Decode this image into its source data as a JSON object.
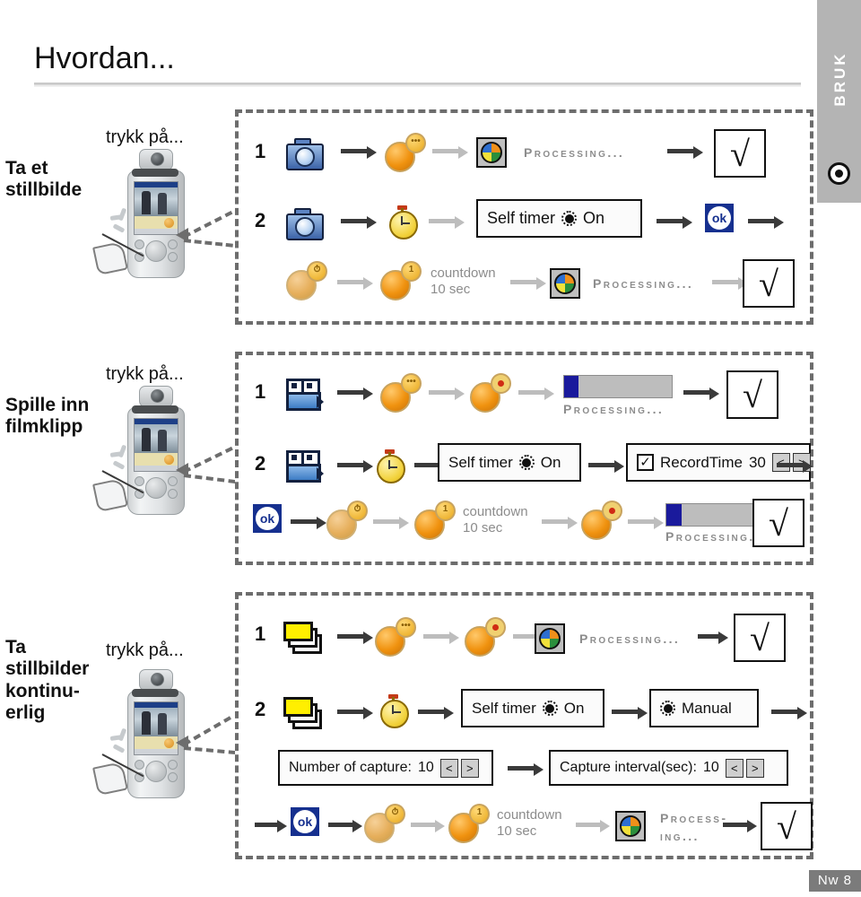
{
  "page": {
    "title": "Hvordan...",
    "footer_badge": "Nw 8",
    "sidebar_tab_label": "BRUK",
    "sidebar_icon": "bullseye-icon"
  },
  "sections": [
    {
      "id": "still-photo",
      "label": "Ta et\nstillbilde",
      "press_label": "trykk på...",
      "device_icon": "pda-camera-device",
      "steps": [
        {
          "num": "1",
          "items": [
            {
              "kind": "icon",
              "icon": "still-camera-icon"
            },
            {
              "kind": "arrow",
              "tone": "dark"
            },
            {
              "kind": "icon",
              "icon": "shutter-orb-icon",
              "badge": "•••"
            },
            {
              "kind": "arrow",
              "tone": "light"
            },
            {
              "kind": "icon",
              "icon": "color-wheel-icon"
            },
            {
              "kind": "text",
              "text": "Processing...",
              "style": "processing"
            },
            {
              "kind": "arrow",
              "tone": "dark"
            },
            {
              "kind": "icon",
              "icon": "checkmark-box",
              "glyph": "√"
            }
          ]
        },
        {
          "num": "2",
          "items": [
            {
              "kind": "icon",
              "icon": "still-camera-icon"
            },
            {
              "kind": "arrow",
              "tone": "dark"
            },
            {
              "kind": "icon",
              "icon": "stopwatch-icon"
            },
            {
              "kind": "arrow",
              "tone": "light"
            },
            {
              "kind": "dialog",
              "text": "Self timer",
              "control": "radio-on",
              "value": "On"
            },
            {
              "kind": "arrow",
              "tone": "dark"
            },
            {
              "kind": "icon",
              "icon": "ok-button-icon",
              "label": "ok"
            },
            {
              "kind": "arrow",
              "tone": "dark"
            }
          ]
        },
        {
          "num": "",
          "items": [
            {
              "kind": "icon",
              "icon": "shutter-orb-icon",
              "badge": "timer"
            },
            {
              "kind": "arrow",
              "tone": "light"
            },
            {
              "kind": "icon",
              "icon": "shutter-orb-icon",
              "badge": "1"
            },
            {
              "kind": "text",
              "text": "countdown",
              "text2": "10 sec",
              "style": "countdown"
            },
            {
              "kind": "arrow",
              "tone": "light"
            },
            {
              "kind": "icon",
              "icon": "color-wheel-icon"
            },
            {
              "kind": "text",
              "text": "Processing...",
              "style": "processing"
            },
            {
              "kind": "arrow",
              "tone": "light"
            },
            {
              "kind": "icon",
              "icon": "checkmark-box",
              "glyph": "√"
            }
          ]
        }
      ]
    },
    {
      "id": "video-clip",
      "label": "Spille inn\nfilmklipp",
      "press_label": "trykk på...",
      "device_icon": "pda-camera-device",
      "steps": [
        {
          "num": "1",
          "items": [
            {
              "kind": "icon",
              "icon": "video-camera-icon"
            },
            {
              "kind": "arrow",
              "tone": "dark"
            },
            {
              "kind": "icon",
              "icon": "shutter-orb-icon",
              "badge": "•••"
            },
            {
              "kind": "arrow",
              "tone": "light"
            },
            {
              "kind": "icon",
              "icon": "shutter-orb-icon",
              "badge": "rec"
            },
            {
              "kind": "arrow",
              "tone": "light"
            },
            {
              "kind": "progress",
              "percent": 13,
              "caption": "Processing..."
            },
            {
              "kind": "arrow",
              "tone": "dark"
            },
            {
              "kind": "icon",
              "icon": "checkmark-box",
              "glyph": "√"
            }
          ]
        },
        {
          "num": "2",
          "items": [
            {
              "kind": "icon",
              "icon": "video-camera-icon"
            },
            {
              "kind": "arrow",
              "tone": "dark"
            },
            {
              "kind": "icon",
              "icon": "stopwatch-icon"
            },
            {
              "kind": "arrow",
              "tone": "dark"
            },
            {
              "kind": "dialog",
              "text": "Self timer",
              "control": "radio-on",
              "value": "On"
            },
            {
              "kind": "arrow",
              "tone": "dark"
            },
            {
              "kind": "dialog",
              "text": "RecordTime",
              "control": "checkbox-on",
              "value": "30",
              "spinner": [
                "<",
                ">"
              ]
            },
            {
              "kind": "arrow",
              "tone": "dark"
            }
          ]
        },
        {
          "num": "",
          "items": [
            {
              "kind": "icon",
              "icon": "ok-button-icon",
              "label": "ok"
            },
            {
              "kind": "arrow",
              "tone": "dark"
            },
            {
              "kind": "icon",
              "icon": "shutter-orb-icon",
              "badge": "timer"
            },
            {
              "kind": "arrow",
              "tone": "light"
            },
            {
              "kind": "icon",
              "icon": "shutter-orb-icon",
              "badge": "1"
            },
            {
              "kind": "text",
              "text": "countdown",
              "text2": "10 sec",
              "style": "countdown"
            },
            {
              "kind": "arrow",
              "tone": "light"
            },
            {
              "kind": "icon",
              "icon": "shutter-orb-icon",
              "badge": "rec"
            },
            {
              "kind": "arrow",
              "tone": "light"
            },
            {
              "kind": "progress",
              "percent": 13,
              "caption": "Processing..."
            },
            {
              "kind": "arrow",
              "tone": "dark"
            },
            {
              "kind": "icon",
              "icon": "checkmark-box",
              "glyph": "√"
            }
          ]
        }
      ]
    },
    {
      "id": "burst-photos",
      "label": "Ta\nstillbilder\nkontinu-\nerlig",
      "press_label": "trykk på...",
      "device_icon": "pda-camera-device",
      "steps": [
        {
          "num": "1",
          "items": [
            {
              "kind": "icon",
              "icon": "photo-stack-icon"
            },
            {
              "kind": "arrow",
              "tone": "dark"
            },
            {
              "kind": "icon",
              "icon": "shutter-orb-icon",
              "badge": "•••"
            },
            {
              "kind": "arrow",
              "tone": "light"
            },
            {
              "kind": "icon",
              "icon": "shutter-orb-icon",
              "badge": "rec"
            },
            {
              "kind": "arrow",
              "tone": "light"
            },
            {
              "kind": "icon",
              "icon": "color-wheel-icon"
            },
            {
              "kind": "text",
              "text": "Processing...",
              "style": "processing"
            },
            {
              "kind": "arrow",
              "tone": "dark"
            },
            {
              "kind": "icon",
              "icon": "checkmark-box",
              "glyph": "√"
            }
          ]
        },
        {
          "num": "2",
          "items": [
            {
              "kind": "icon",
              "icon": "photo-stack-icon"
            },
            {
              "kind": "arrow",
              "tone": "dark"
            },
            {
              "kind": "icon",
              "icon": "stopwatch-icon"
            },
            {
              "kind": "arrow",
              "tone": "dark"
            },
            {
              "kind": "dialog",
              "text": "Self timer",
              "control": "radio-on",
              "value": "On"
            },
            {
              "kind": "arrow",
              "tone": "dark"
            },
            {
              "kind": "dialog",
              "text": "Manual",
              "control": "radio-on"
            },
            {
              "kind": "arrow",
              "tone": "dark"
            }
          ]
        },
        {
          "num": "",
          "items": [
            {
              "kind": "dialog",
              "text": "Number of capture:",
              "value": "10",
              "spinner": [
                "<",
                ">"
              ]
            },
            {
              "kind": "arrow",
              "tone": "dark"
            },
            {
              "kind": "dialog",
              "text": "Capture interval(sec):",
              "value": "10",
              "spinner": [
                "<",
                ">"
              ]
            }
          ]
        },
        {
          "num": "",
          "items": [
            {
              "kind": "arrow",
              "tone": "dark"
            },
            {
              "kind": "icon",
              "icon": "ok-button-icon",
              "label": "ok"
            },
            {
              "kind": "arrow",
              "tone": "dark"
            },
            {
              "kind": "icon",
              "icon": "shutter-orb-icon",
              "badge": "timer"
            },
            {
              "kind": "arrow",
              "tone": "light"
            },
            {
              "kind": "icon",
              "icon": "shutter-orb-icon",
              "badge": "1"
            },
            {
              "kind": "text",
              "text": "countdown",
              "text2": "10 sec",
              "style": "countdown"
            },
            {
              "kind": "arrow",
              "tone": "light"
            },
            {
              "kind": "icon",
              "icon": "color-wheel-icon"
            },
            {
              "kind": "text",
              "text": "Process-",
              "text2": "ing...",
              "style": "processing"
            },
            {
              "kind": "arrow",
              "tone": "dark"
            },
            {
              "kind": "icon",
              "icon": "checkmark-box",
              "glyph": "√"
            }
          ]
        }
      ]
    }
  ],
  "labels": {
    "sec1_line1": "Ta et",
    "sec1_line2": "stillbilde",
    "sec2_line1": "Spille inn",
    "sec2_line2": "filmklipp",
    "sec3_line1": "Ta",
    "sec3_line2": "stillbilder",
    "sec3_line3": "kontinu-",
    "sec3_line4": "erlig",
    "press": "trykk på...",
    "processing": "Processing...",
    "processing_a": "Process-",
    "processing_b": "ing...",
    "countdown_a": "countdown",
    "countdown_b": "10 sec",
    "self_timer": "Self timer",
    "on": "On",
    "record_time": "RecordTime",
    "record_time_value": "30",
    "manual": "Manual",
    "number_of_capture": "Number of capture:",
    "number_of_capture_value": "10",
    "capture_interval": "Capture interval(sec):",
    "capture_interval_value": "10",
    "ok": "ok",
    "check": "√",
    "spin_prev": "<",
    "spin_next": ">",
    "step1": "1",
    "step2": "2",
    "badge_one": "1"
  },
  "colors": {
    "accent_blue": "#16308f",
    "orange": "#f0920f",
    "dash_gray": "#6d6d6d",
    "sidebar_gray": "#b4b4b4",
    "footer_gray": "#7b7b7b",
    "processing_gray": "#8c8c8c",
    "progress_fill": "#1a1a9c"
  }
}
